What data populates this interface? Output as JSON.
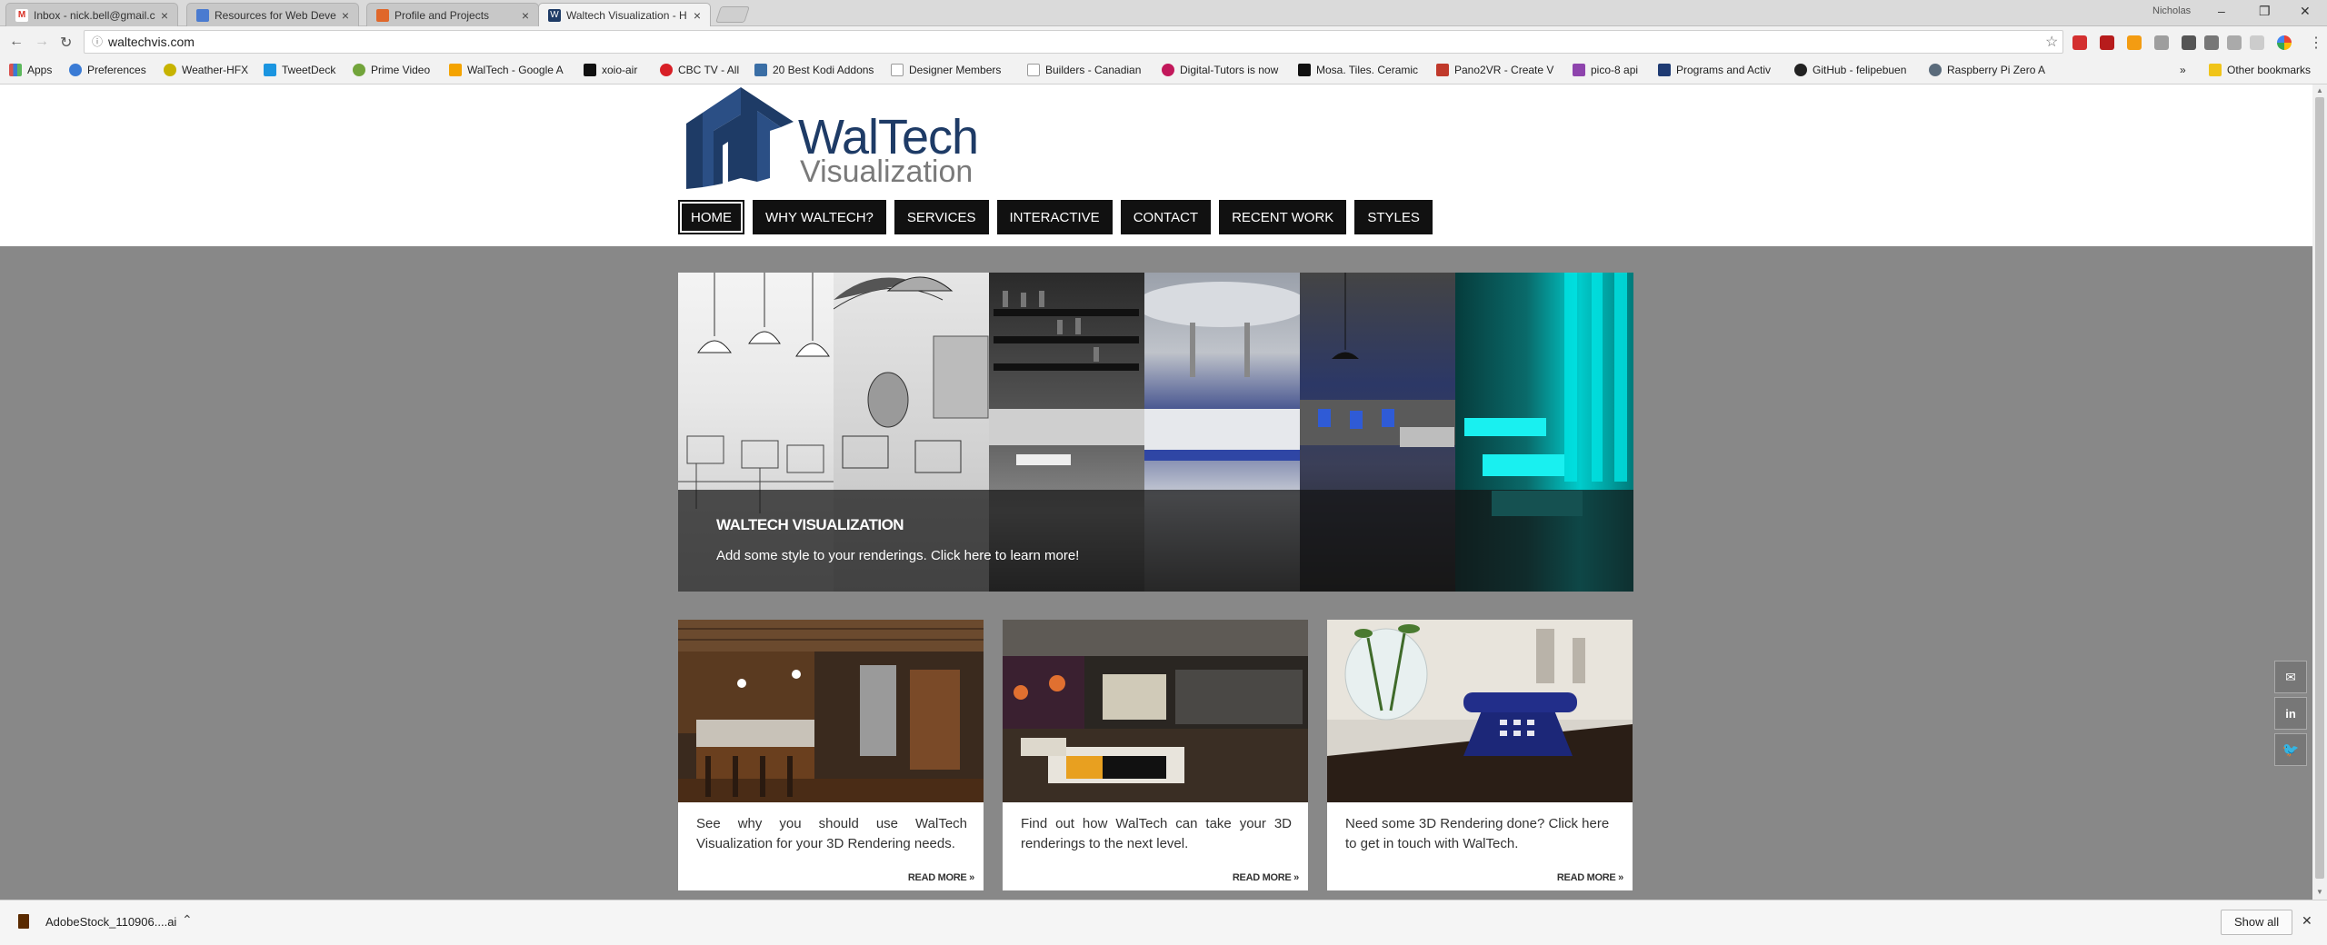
{
  "tabs": [
    {
      "title": "Inbox - nick.bell@gmail.c",
      "icon": "gmail-icon",
      "color": "#d93025"
    },
    {
      "title": "Resources for Web Devel",
      "icon": "resources-icon",
      "color": "#4a7bd0"
    },
    {
      "title": "Profile and Projects",
      "icon": "profile-icon",
      "color": "#e0672a"
    },
    {
      "title": "Waltech Visualization - H",
      "icon": "waltech-icon",
      "color": "#1e3b66"
    }
  ],
  "window": {
    "profile": "Nicholas",
    "minimize": "–",
    "restore": "❐",
    "close": "✕"
  },
  "address": {
    "url": "waltechvis.com"
  },
  "bookmarks": [
    {
      "label": "Apps",
      "color": "#d9534f"
    },
    {
      "label": "Preferences",
      "color": "#3a7bd5"
    },
    {
      "label": "Weather-HFX",
      "color": "#c7b300"
    },
    {
      "label": "TweetDeck",
      "color": "#1b95e0"
    },
    {
      "label": "Prime Video",
      "color": "#72a43b"
    },
    {
      "label": "WalTech - Google A",
      "color": "#f4a300"
    },
    {
      "label": "xoio-air",
      "color": "#111111"
    },
    {
      "label": "CBC TV - All",
      "color": "#d81f26"
    },
    {
      "label": "20 Best Kodi Addons",
      "color": "#3a6ea5"
    },
    {
      "label": "Designer Members",
      "color": "#dddddd"
    },
    {
      "label": "Builders - Canadian",
      "color": "#dddddd"
    },
    {
      "label": "Digital-Tutors is now",
      "color": "#c2185b"
    },
    {
      "label": "Mosa. Tiles. Ceramic",
      "color": "#111111"
    },
    {
      "label": "Pano2VR - Create V",
      "color": "#c0392b"
    },
    {
      "label": "pico-8 api",
      "color": "#8e44ad"
    },
    {
      "label": "Programs and Activ",
      "color": "#1f3b73"
    },
    {
      "label": "GitHub - felipebuen",
      "color": "#222222"
    },
    {
      "label": "Raspberry Pi Zero A",
      "color": "#5a6b7b"
    },
    {
      "label": "Other bookmarks",
      "color": "#f0c419"
    }
  ],
  "bookmarks_overflow": "»",
  "site": {
    "logo_line1": "WalTech",
    "logo_line2": "Visualization",
    "nav": [
      "HOME",
      "WHY WALTECH?",
      "SERVICES",
      "INTERACTIVE",
      "CONTACT",
      "RECENT WORK",
      "STYLES"
    ],
    "active_nav": "HOME",
    "hero": {
      "title": "WALTECH VISUALIZATION",
      "subtitle": "Add some style to your renderings. Click here to learn more!"
    },
    "cards": [
      {
        "text": "See why you should use WalTech Visualization for your 3D Rendering needs.",
        "more": "READ MORE »"
      },
      {
        "text": "Find out how WalTech can take your 3D renderings to the next level.",
        "more": "READ MORE »"
      },
      {
        "text": "Need some 3D Rendering done? Click here to get in touch with WalTech.",
        "more": "READ MORE »"
      }
    ],
    "social": [
      "email-icon",
      "linkedin-icon",
      "twitter-icon"
    ]
  },
  "download": {
    "filename": "AdobeStock_110906....ai",
    "show_all": "Show all"
  },
  "colors": {
    "brand_navy": "#1e3b66",
    "brand_gray": "#7a7a7a",
    "content_bg": "#888888",
    "nav_bg": "#111111"
  }
}
